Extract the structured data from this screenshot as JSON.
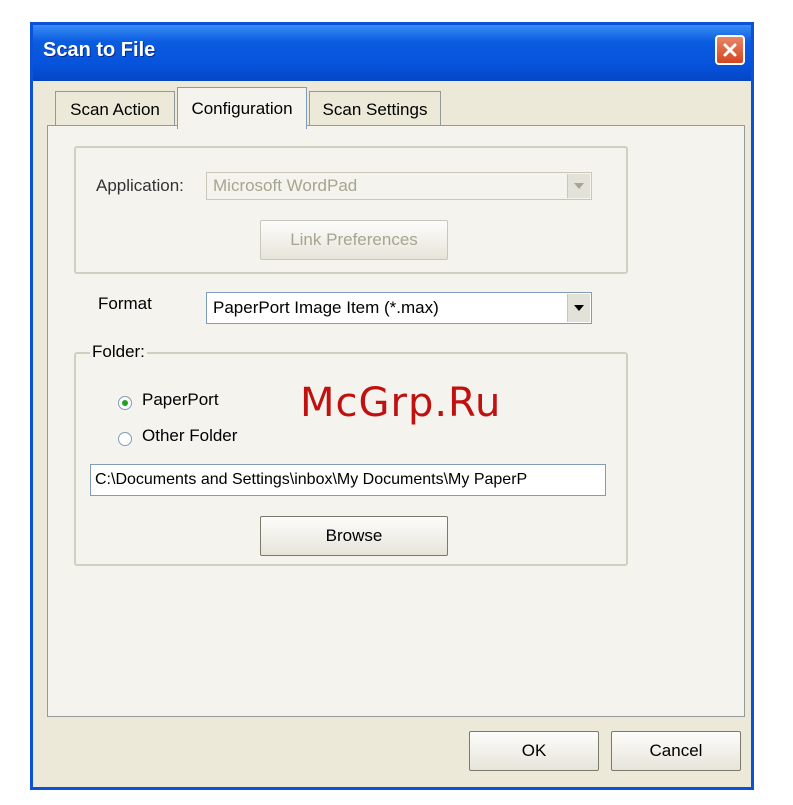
{
  "window": {
    "title": "Scan to File"
  },
  "tabs": [
    {
      "label": "Scan Action"
    },
    {
      "label": "Configuration"
    },
    {
      "label": "Scan Settings"
    }
  ],
  "application": {
    "label": "Application:",
    "value": "Microsoft WordPad",
    "link_preferences_label": "Link Preferences"
  },
  "format": {
    "label": "Format",
    "value": "PaperPort Image Item (*.max)"
  },
  "folder": {
    "label": "Folder:",
    "options": [
      {
        "label": "PaperPort",
        "selected": true
      },
      {
        "label": "Other Folder",
        "selected": false
      }
    ],
    "path": "C:\\Documents and Settings\\inbox\\My Documents\\My PaperP",
    "browse_label": "Browse"
  },
  "buttons": {
    "ok": "OK",
    "cancel": "Cancel"
  },
  "watermark": "McGrp.Ru",
  "icons": {
    "close": "close-icon",
    "dropdown": "chevron-down-icon",
    "radio": "radio-icon"
  },
  "colors": {
    "titlebar": "#0a5ce0",
    "close": "#d2461f",
    "dialog": "#ece9d8",
    "watermark": "#c01010"
  }
}
